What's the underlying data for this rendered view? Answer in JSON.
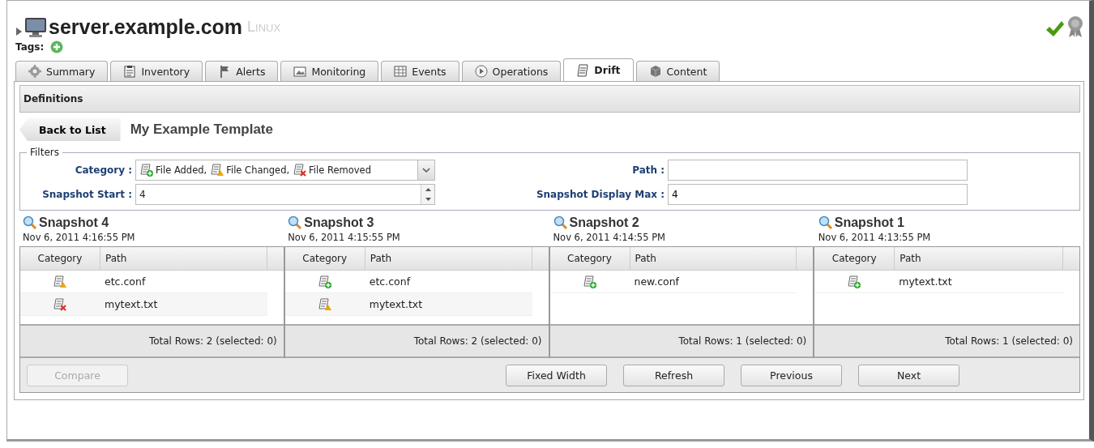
{
  "header": {
    "title": "server.example.com",
    "platform": "Linux",
    "tags_label": "Tags:"
  },
  "tabs": [
    {
      "label": "Summary",
      "kind": "gear",
      "selected": false
    },
    {
      "label": "Inventory",
      "kind": "clipboard",
      "selected": false
    },
    {
      "label": "Alerts",
      "kind": "flag",
      "selected": false
    },
    {
      "label": "Monitoring",
      "kind": "chart",
      "selected": false
    },
    {
      "label": "Events",
      "kind": "grid",
      "selected": false
    },
    {
      "label": "Operations",
      "kind": "play",
      "selected": false
    },
    {
      "label": "Drift",
      "kind": "doc",
      "selected": true
    },
    {
      "label": "Content",
      "kind": "cube",
      "selected": false
    }
  ],
  "section_title": "Definitions",
  "back_button": "Back to List",
  "template_name": "My Example Template",
  "filters": {
    "legend": "Filters",
    "category": {
      "label": "Category :",
      "items": [
        {
          "kind": "added",
          "text": "File Added,"
        },
        {
          "kind": "changed",
          "text": "File Changed,"
        },
        {
          "kind": "removed",
          "text": "File Removed"
        }
      ]
    },
    "snapshot_start": {
      "label": "Snapshot Start :",
      "value": "4"
    },
    "path": {
      "label": "Path :"
    },
    "snapshot_display_max": {
      "label": "Snapshot Display Max :",
      "value": "4"
    }
  },
  "snapshots": [
    {
      "title": "Snapshot 4",
      "date": "Nov 6, 2011 4:16:55 PM",
      "columns": [
        "Category",
        "Path"
      ],
      "rows": [
        {
          "kind": "changed",
          "path": "etc.conf"
        },
        {
          "kind": "removed",
          "path": "mytext.txt"
        }
      ],
      "footer": "Total Rows: 2 (selected: 0)"
    },
    {
      "title": "Snapshot 3",
      "date": "Nov 6, 2011 4:15:55 PM",
      "columns": [
        "Category",
        "Path"
      ],
      "rows": [
        {
          "kind": "added",
          "path": "etc.conf"
        },
        {
          "kind": "changed",
          "path": "mytext.txt"
        }
      ],
      "footer": "Total Rows: 2 (selected: 0)"
    },
    {
      "title": "Snapshot 2",
      "date": "Nov 6, 2011 4:14:55 PM",
      "columns": [
        "Category",
        "Path"
      ],
      "rows": [
        {
          "kind": "added",
          "path": "new.conf"
        }
      ],
      "footer": "Total Rows: 1 (selected: 0)"
    },
    {
      "title": "Snapshot 1",
      "date": "Nov 6, 2011 4:13:55 PM",
      "columns": [
        "Category",
        "Path"
      ],
      "rows": [
        {
          "kind": "added",
          "path": "mytext.txt"
        }
      ],
      "footer": "Total Rows: 1 (selected: 0)"
    }
  ],
  "buttons": [
    {
      "label": "Compare",
      "disabled": true,
      "kind": "left"
    },
    {
      "label": "Fixed Width",
      "disabled": false,
      "kind": "right"
    },
    {
      "label": "Refresh",
      "disabled": false,
      "kind": "right"
    },
    {
      "label": "Previous",
      "disabled": false,
      "kind": "right"
    },
    {
      "label": "Next",
      "disabled": false,
      "kind": "right"
    }
  ]
}
